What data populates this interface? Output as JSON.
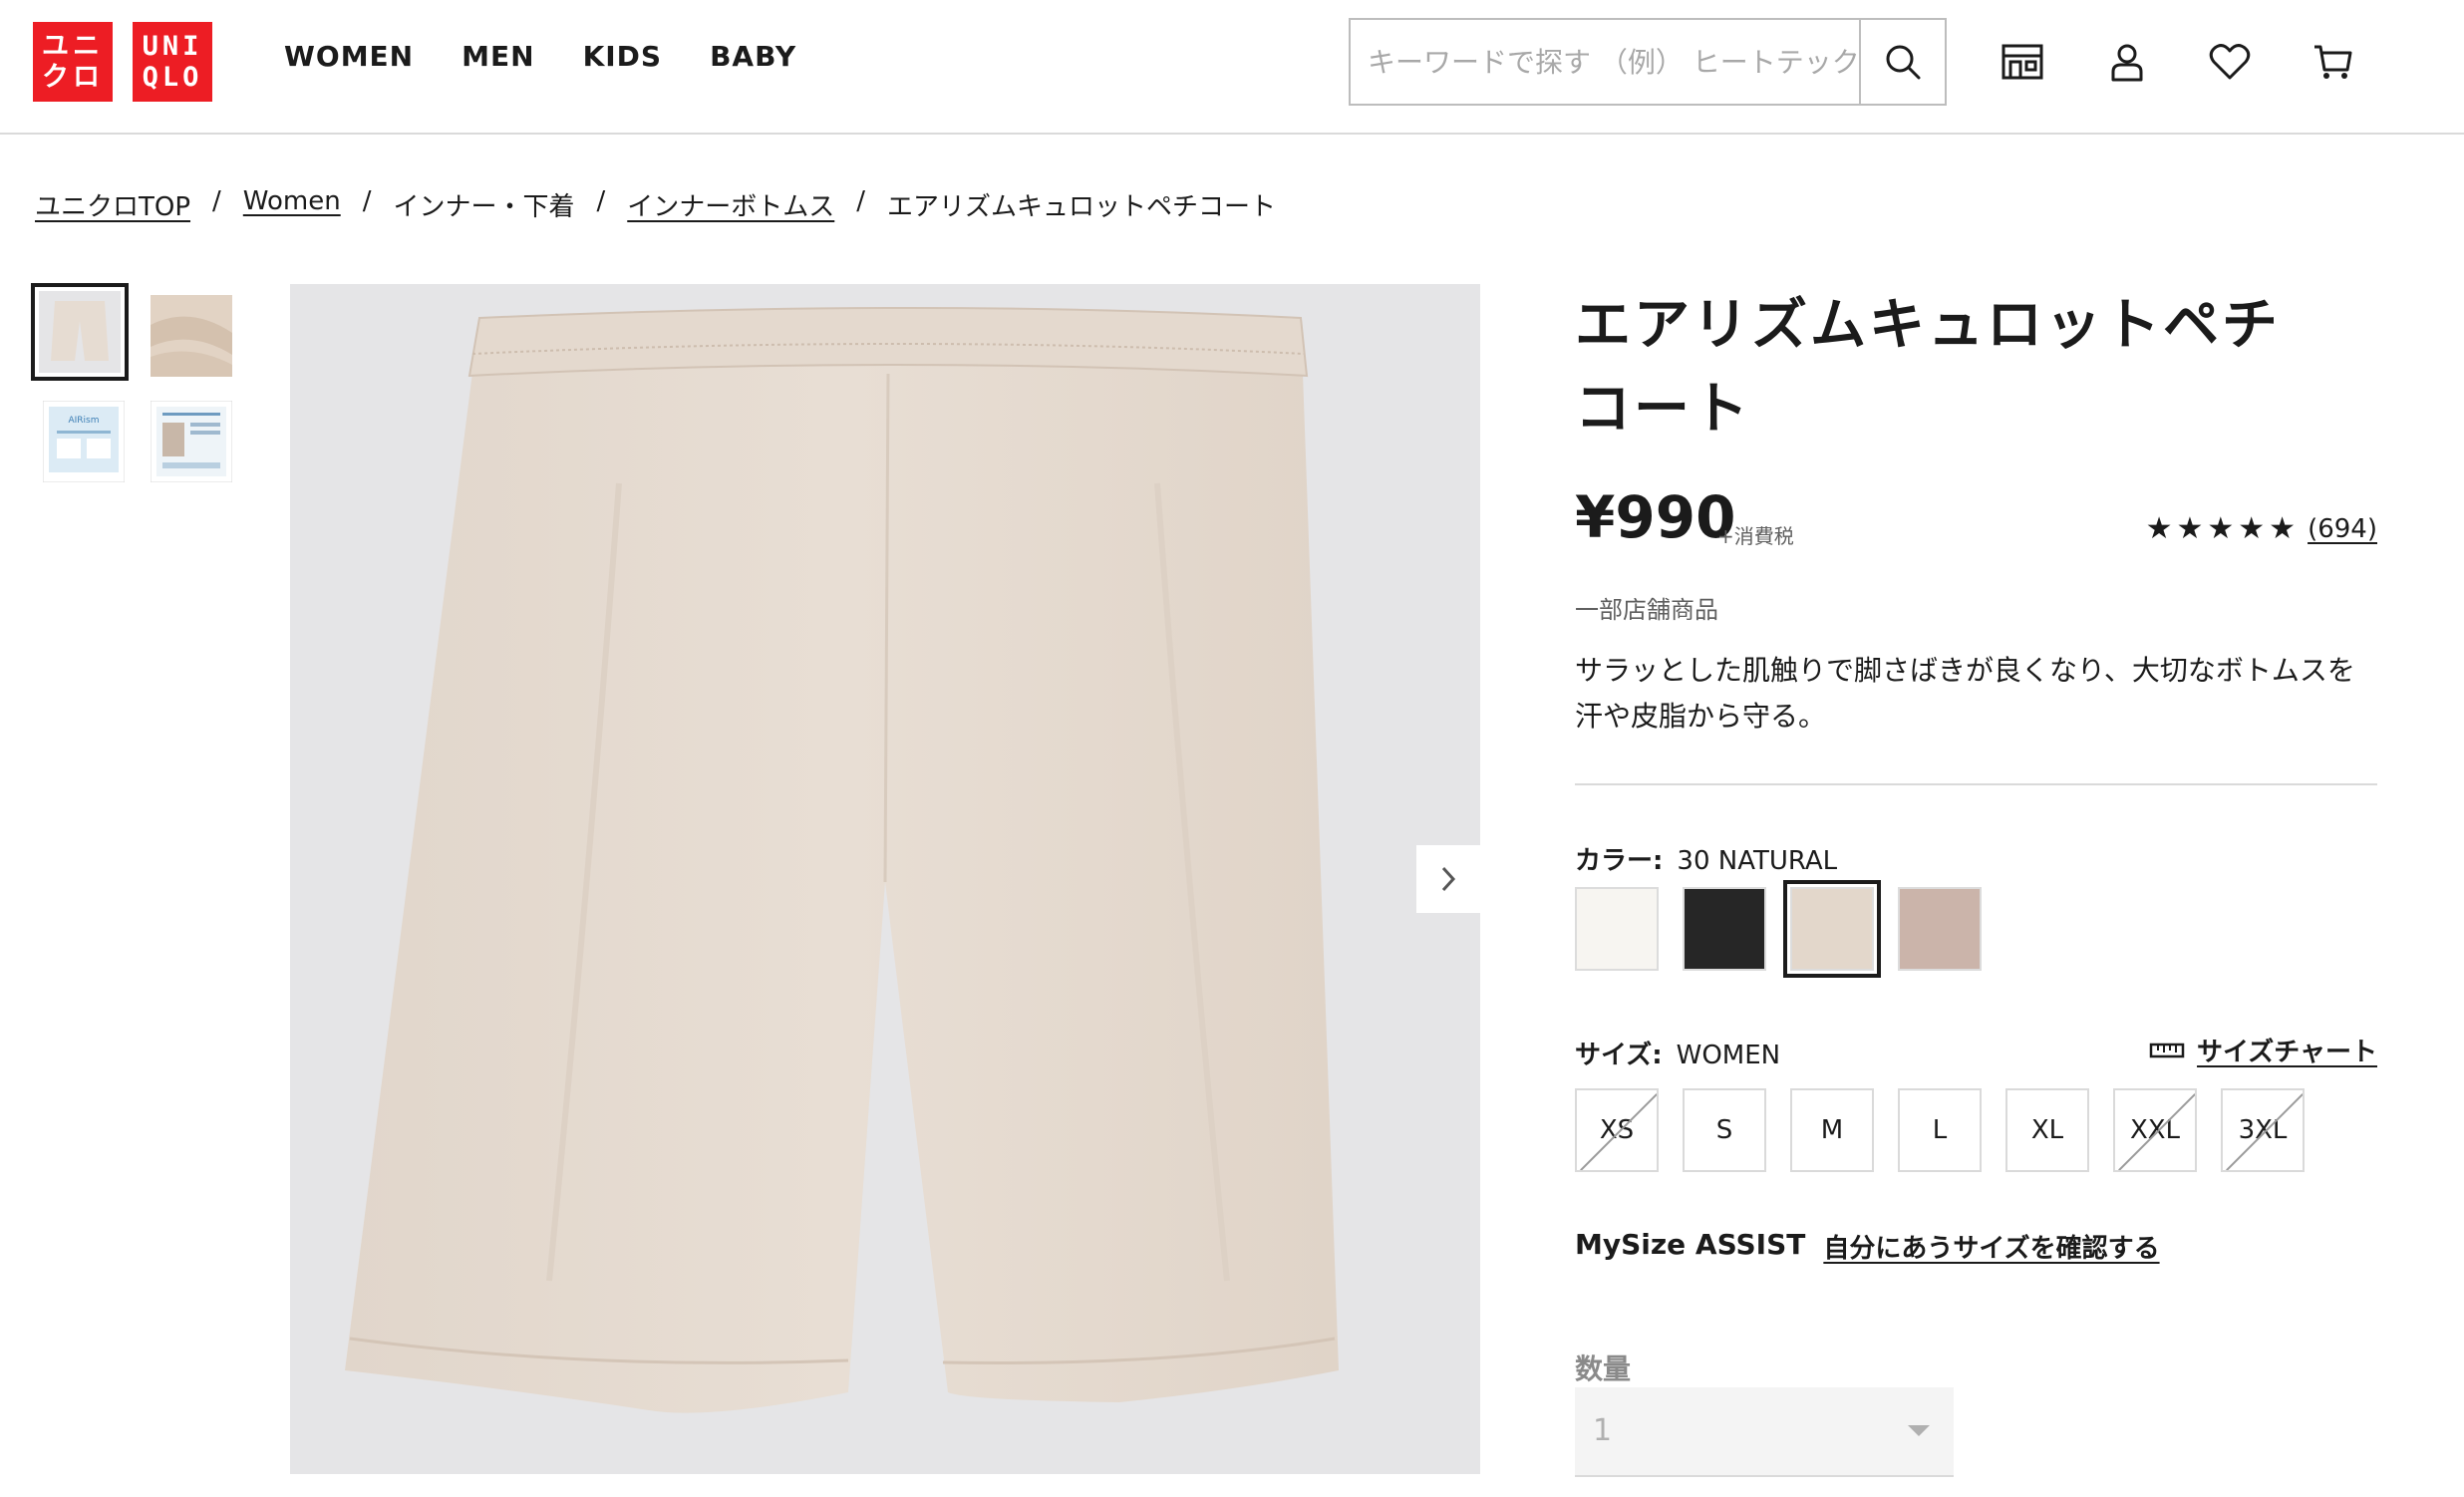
{
  "header": {
    "logo_ja": [
      "ユニ",
      "クロ"
    ],
    "logo_en": [
      "UNI",
      "QLO"
    ],
    "nav": [
      "WOMEN",
      "MEN",
      "KIDS",
      "BABY"
    ],
    "search_placeholder": "キーワードで探す （例） ヒートテック",
    "icons": [
      "store-icon",
      "account-icon",
      "heart-icon",
      "cart-icon"
    ]
  },
  "breadcrumb": [
    {
      "label": "ユニクロTOP",
      "link": true
    },
    {
      "label": "Women",
      "link": true
    },
    {
      "label": "インナー・下着",
      "link": false
    },
    {
      "label": "インナーボトムス",
      "link": true
    },
    {
      "label": "エアリズムキュロットペチコート",
      "link": false
    }
  ],
  "breadcrumb_sep": "/",
  "product": {
    "title": "エアリズムキュロットペチコート",
    "price": "¥990",
    "tax": "+消費税",
    "stars": "★★★★★",
    "rating": 4.5,
    "review_count": "(694)",
    "store_note": "一部店舗商品",
    "description": "サラッとした肌触りで脚さばきが良くなり、大切なボトムスを汗や皮脂から守る。",
    "color_label": "カラー:",
    "color_value": "30 NATURAL",
    "colors": [
      {
        "name": "off-white",
        "hex": "#f7f5f1"
      },
      {
        "name": "black",
        "hex": "#262626"
      },
      {
        "name": "natural",
        "hex": "#e3d7cb",
        "selected": true
      },
      {
        "name": "pink-beige",
        "hex": "#cbb4aa"
      }
    ],
    "size_label": "サイズ:",
    "size_value": "WOMEN",
    "size_chart": "サイズチャート",
    "sizes": [
      {
        "label": "XS",
        "available": false
      },
      {
        "label": "S",
        "available": true
      },
      {
        "label": "M",
        "available": true
      },
      {
        "label": "L",
        "available": true
      },
      {
        "label": "XL",
        "available": true
      },
      {
        "label": "XXL",
        "available": false
      },
      {
        "label": "3XL",
        "available": false
      }
    ],
    "mysize_title": "MySize ASSIST",
    "mysize_link": "自分にあうサイズを確認する",
    "quantity_label": "数量",
    "quantity_value": "1"
  },
  "colors": {
    "brand_red": "#ed1d24",
    "image_bg": "#e5e5e7",
    "garment": "#e6dcd2"
  }
}
